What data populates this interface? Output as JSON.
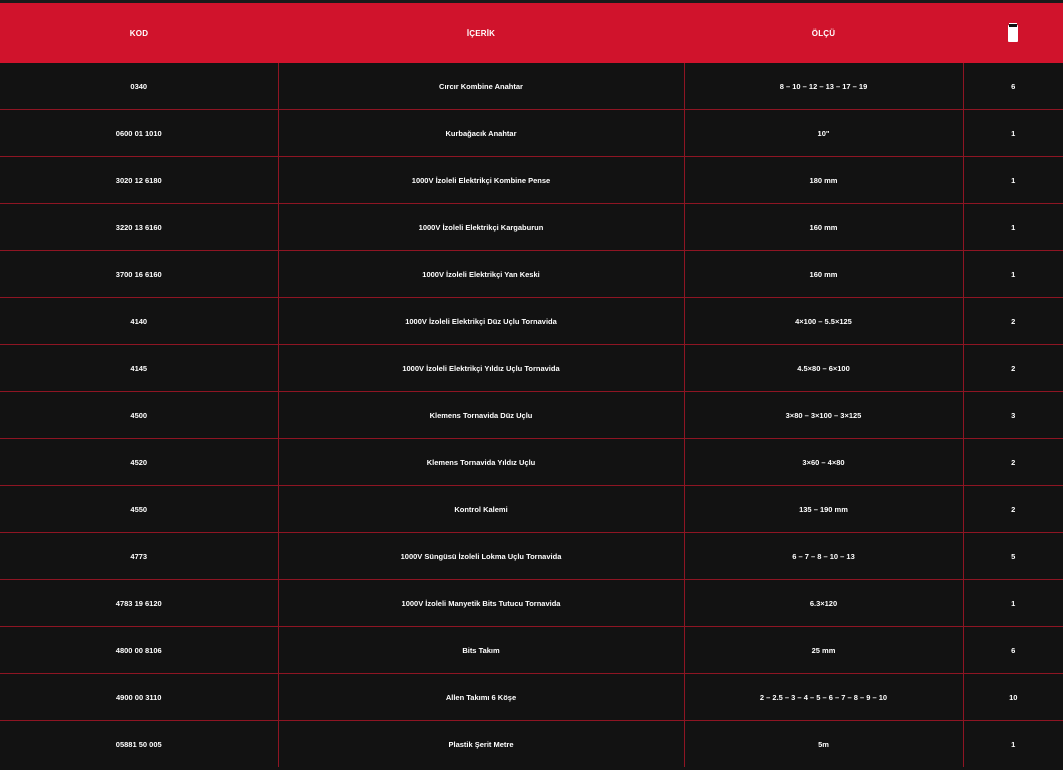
{
  "table": {
    "headers": {
      "code": "KOD",
      "content": "İÇERİK",
      "size": "ÖLÇÜ",
      "quantity_icon": "package-icon"
    },
    "rows": [
      {
        "code": "0340",
        "content": "Cırcır Kombine Anahtar",
        "size": "8 – 10 – 12 – 13 – 17 – 19",
        "qty": "6"
      },
      {
        "code": "0600 01 1010",
        "content": "Kurbağacık Anahtar",
        "size": "10\"",
        "qty": "1"
      },
      {
        "code": "3020 12 6180",
        "content": "1000V İzoleli Elektrikçi Kombine Pense",
        "size": "180 mm",
        "qty": "1"
      },
      {
        "code": "3220 13 6160",
        "content": "1000V İzoleli Elektrikçi Kargaburun",
        "size": "160 mm",
        "qty": "1"
      },
      {
        "code": "3700 16 6160",
        "content": "1000V İzoleli Elektrikçi Yan Keski",
        "size": "160 mm",
        "qty": "1"
      },
      {
        "code": "4140",
        "content": "1000V İzoleli Elektrikçi Düz Uçlu Tornavida",
        "size": "4×100 – 5.5×125",
        "qty": "2"
      },
      {
        "code": "4145",
        "content": "1000V İzoleli Elektrikçi Yıldız Uçlu Tornavida",
        "size": "4.5×80 – 6×100",
        "qty": "2"
      },
      {
        "code": "4500",
        "content": "Klemens Tornavida Düz Uçlu",
        "size": "3×80 – 3×100 – 3×125",
        "qty": "3"
      },
      {
        "code": "4520",
        "content": "Klemens Tornavida Yıldız Uçlu",
        "size": "3×60 – 4×80",
        "qty": "2"
      },
      {
        "code": "4550",
        "content": "Kontrol Kalemi",
        "size": "135 – 190 mm",
        "qty": "2"
      },
      {
        "code": "4773",
        "content": "1000V Süngüsü İzoleli Lokma Uçlu Tornavida",
        "size": "6 – 7 – 8 – 10 – 13",
        "qty": "5"
      },
      {
        "code": "4783 19 6120",
        "content": "1000V İzoleli Manyetik Bits Tutucu Tornavida",
        "size": "6.3×120",
        "qty": "1"
      },
      {
        "code": "4800 00 8106",
        "content": "Bits Takım",
        "size": "25 mm",
        "qty": "6"
      },
      {
        "code": "4900 00 3110",
        "content": "Allen Takımı 6 Köşe",
        "size": "2 – 2.5 – 3 – 4 – 5 – 6 – 7 – 8 – 9 – 10",
        "qty": "10"
      },
      {
        "code": "05881 50 005",
        "content": "Plastik Şerit Metre",
        "size": "5m",
        "qty": "1"
      }
    ]
  },
  "colors": {
    "header_bg": "#d0132c",
    "row_bg": "#121212",
    "divider": "#8e1523"
  }
}
